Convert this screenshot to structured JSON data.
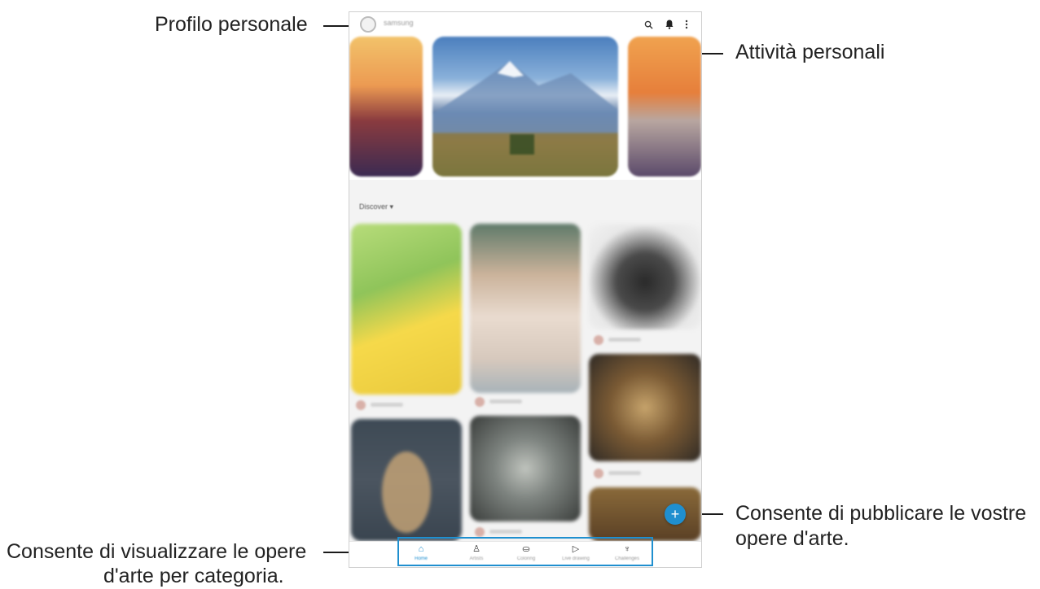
{
  "annotations": {
    "profile": "Profilo personale",
    "activities": "Attività personali",
    "publish_line1": "Consente di pubblicare le vostre",
    "publish_line2": "opere d'arte.",
    "categories_line1": "Consente di visualizzare le opere",
    "categories_line2": "d'arte per categoria."
  },
  "topbar": {
    "username": "samsung",
    "icons": [
      "search-icon",
      "bell-icon",
      "more-icon"
    ]
  },
  "section": {
    "filter_label": "Discover"
  },
  "fab": {
    "label": "+"
  },
  "bottom_nav": [
    {
      "icon": "home-icon",
      "label": "Home"
    },
    {
      "icon": "artists-icon",
      "label": "Artists"
    },
    {
      "icon": "coloring-icon",
      "label": "Coloring"
    },
    {
      "icon": "live-drawing-icon",
      "label": "Live drawing"
    },
    {
      "icon": "challenges-icon",
      "label": "Challenges"
    }
  ],
  "colors": {
    "accent": "#1f8fcf"
  }
}
